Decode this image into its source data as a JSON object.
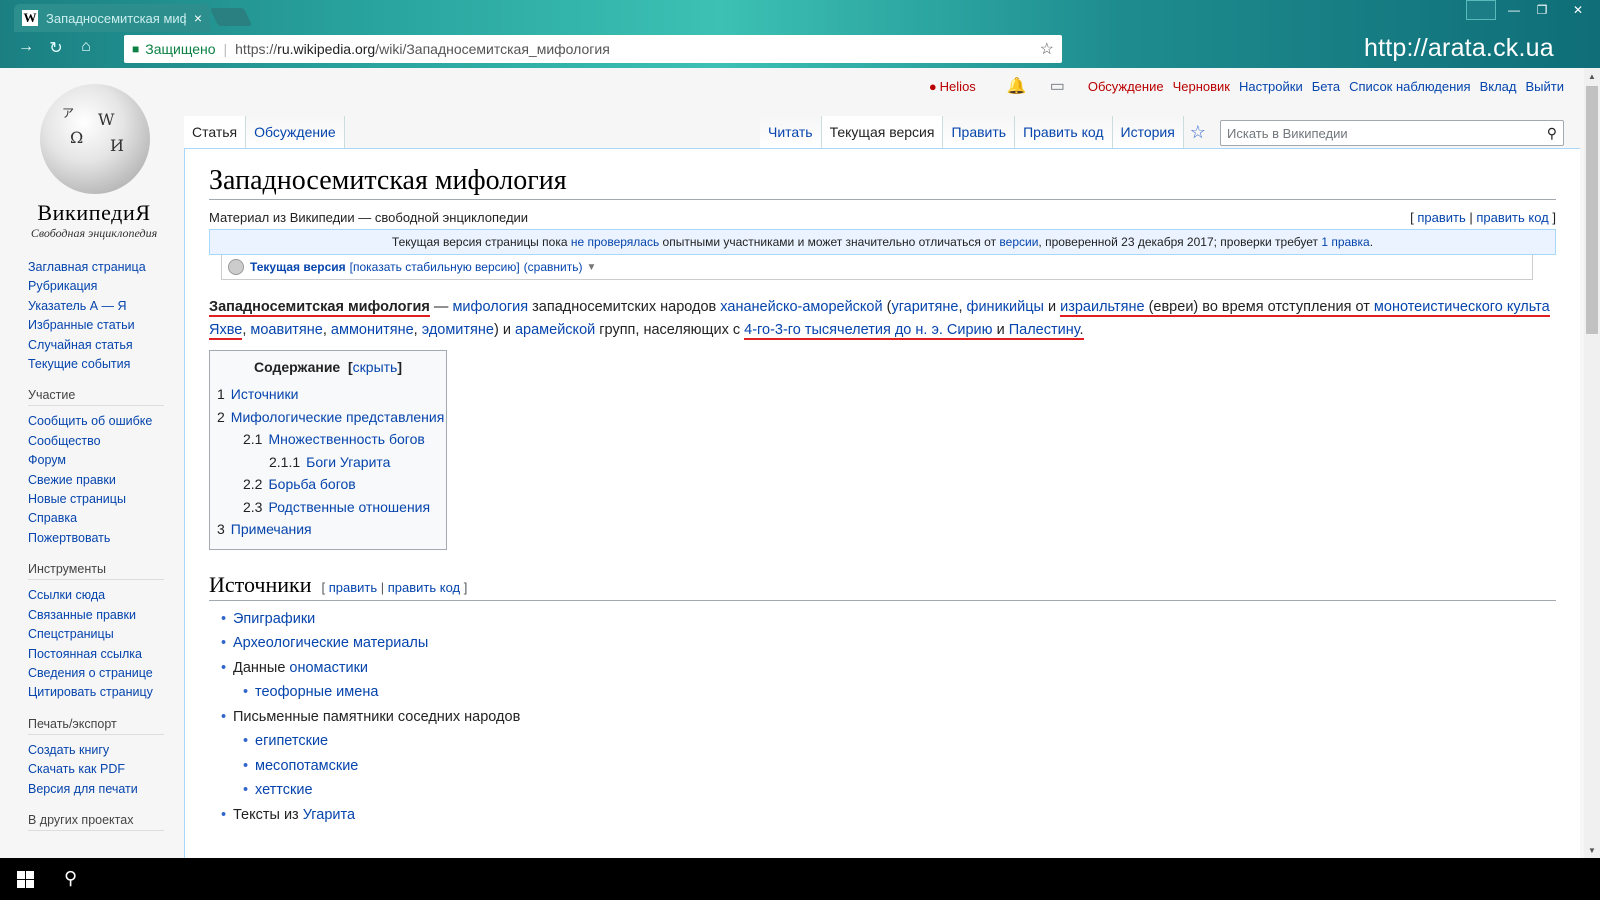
{
  "browser": {
    "tab_title": "Западносемитская миф",
    "tab_close": "×",
    "secure_label": "Защищено",
    "url_scheme": "https://",
    "url_host": "ru.wikipedia.org",
    "url_path": "/wiki/Западносемитская_мифология",
    "watermark": "http://arata.ck.ua"
  },
  "personal": {
    "user": "Helios",
    "links": [
      "Обсуждение",
      "Черновик",
      "Настройки",
      "Бета",
      "Список наблюдения",
      "Вклад",
      "Выйти"
    ]
  },
  "tabs": {
    "left": [
      "Статья",
      "Обсуждение"
    ],
    "right": [
      "Читать",
      "Текущая версия",
      "Править",
      "Править код",
      "История"
    ],
    "search_placeholder": "Искать в Википедии"
  },
  "logo": {
    "word": "ВикипедиЯ",
    "tagline": "Свободная энциклопедия"
  },
  "sidebar": {
    "main": [
      "Заглавная страница",
      "Рубрикация",
      "Указатель А — Я",
      "Избранные статьи",
      "Случайная статья",
      "Текущие события"
    ],
    "participation_title": "Участие",
    "participation": [
      "Сообщить об ошибке",
      "Сообщество",
      "Форум",
      "Свежие правки",
      "Новые страницы",
      "Справка",
      "Пожертвовать"
    ],
    "tools_title": "Инструменты",
    "tools": [
      "Ссылки сюда",
      "Связанные правки",
      "Спецстраницы",
      "Постоянная ссылка",
      "Сведения о странице",
      "Цитировать страницу"
    ],
    "print_title": "Печать/экспорт",
    "print": [
      "Создать книгу",
      "Скачать как PDF",
      "Версия для печати"
    ],
    "other_title": "В других проектах"
  },
  "article": {
    "title": "Западносемитская мифология",
    "from": "Материал из Википедии — свободной энциклопедии",
    "edit_links": {
      "open": "[ ",
      "edit": "править",
      "sep": " | ",
      "edit_code": "править код",
      "close": " ]"
    },
    "flag": {
      "t1": "Текущая версия страницы пока ",
      "l1": "не проверялась",
      "t2": " опытными участниками и может значительно отличаться от ",
      "l2": "версии",
      "t3": ", проверенной 23 декабря 2017; проверки требует ",
      "l3": "1 правка",
      "t4": "."
    },
    "rev": {
      "current": "Текущая версия",
      "show_stable": "[показать стабильную версию]",
      "compare": "(сравнить)"
    },
    "lead": {
      "bold": "Западносемитская мифология",
      "dash": " — ",
      "a1": "мифология",
      "t1": " западносемитских народов ",
      "a2": "хананейско-аморейской",
      "t2": " (",
      "a3": "угаритяне",
      "t3": ", ",
      "a4": "финикийцы",
      "t4": " и ",
      "a5": "израильтяне",
      "t5": " (евреи) во время отступления от ",
      "a6": "монотеистического культа Яхве",
      "t6": ", ",
      "a7": "моавитяне",
      "t7": ", ",
      "a8": "аммонитяне",
      "t8": ", ",
      "a9": "эдомитяне",
      "t9": ") и ",
      "a10": "арамейской",
      "t10": " групп, населяющих с ",
      "a11": "4-го-3-го тысячелетия до н. э.",
      "t11": " ",
      "a12": "Сирию",
      "t12": " и ",
      "a13": "Палестину",
      "t13": "."
    },
    "toc": {
      "title": "Содержание",
      "hide": "скрыть",
      "items": [
        {
          "num": "1",
          "label": "Источники",
          "level": 1
        },
        {
          "num": "2",
          "label": "Мифологические представления",
          "level": 1
        },
        {
          "num": "2.1",
          "label": "Множественность богов",
          "level": 2
        },
        {
          "num": "2.1.1",
          "label": "Боги Угарита",
          "level": 3
        },
        {
          "num": "2.2",
          "label": "Борьба богов",
          "level": 2
        },
        {
          "num": "2.3",
          "label": "Родственные отношения",
          "level": 2
        },
        {
          "num": "3",
          "label": "Примечания",
          "level": 1
        }
      ]
    },
    "section": {
      "title": "Источники",
      "items": [
        {
          "link": "Эпиграфики"
        },
        {
          "link": "Археологические материалы"
        },
        {
          "text": "Данные ",
          "link": "ономастики"
        },
        {
          "sub": true,
          "link": "теофорные имена"
        },
        {
          "text": "Письменные памятники соседних народов"
        },
        {
          "sub": true,
          "link": "египетские"
        },
        {
          "sub": true,
          "link": "месопотамские"
        },
        {
          "sub": true,
          "link": "хеттские"
        },
        {
          "text": "Тексты из ",
          "link": "Угарита"
        }
      ]
    }
  }
}
